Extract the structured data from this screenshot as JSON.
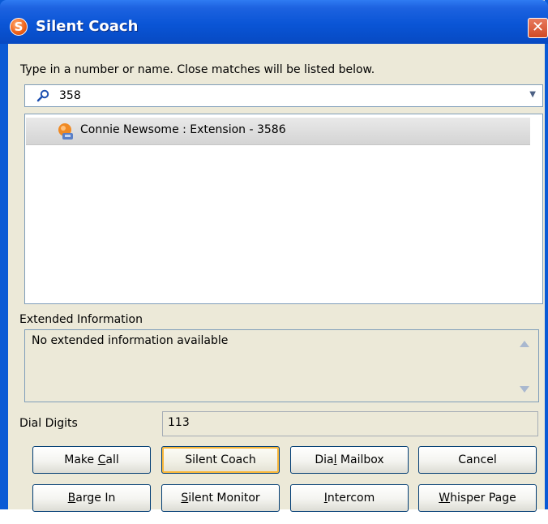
{
  "window": {
    "title": "Silent Coach",
    "app_icon": "S",
    "close": "✕"
  },
  "search": {
    "instruction": "Type in a number or name.  Close matches will be listed below.",
    "value": "358",
    "placeholder": ""
  },
  "results": [
    {
      "label": "Connie Newsome : Extension - 3586",
      "icon": "contact-phone-icon"
    }
  ],
  "extended_info": {
    "label": "Extended Information",
    "text": "No extended information available"
  },
  "dial_digits": {
    "label": "Dial Digits",
    "value": "113"
  },
  "buttons": {
    "make_call": {
      "pre": "Make ",
      "key": "C",
      "post": "all"
    },
    "silent_coach": {
      "pre": "Silent Coach",
      "key": "",
      "post": ""
    },
    "dial_mailbox": {
      "pre": "Dia",
      "key": "l",
      "post": " Mailbox"
    },
    "cancel": {
      "pre": "Cancel",
      "key": "",
      "post": ""
    },
    "barge_in": {
      "pre": "",
      "key": "B",
      "post": "arge In"
    },
    "silent_monitor": {
      "pre": "",
      "key": "S",
      "post": "ilent Monitor"
    },
    "intercom": {
      "pre": "",
      "key": "I",
      "post": "ntercom"
    },
    "whisper_page": {
      "pre": "",
      "key": "W",
      "post": "hisper Page"
    }
  }
}
